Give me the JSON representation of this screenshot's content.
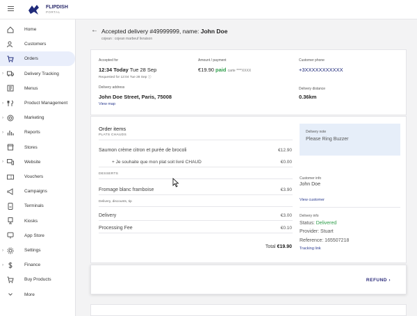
{
  "brand": {
    "name": "FLIPDISH",
    "tag": "PORTAL"
  },
  "sidebar": {
    "items": [
      {
        "label": "Home",
        "icon": "home-icon",
        "caret": false,
        "active": false
      },
      {
        "label": "Customers",
        "icon": "customers-icon",
        "caret": false,
        "active": false
      },
      {
        "label": "Orders",
        "icon": "cart-icon",
        "caret": false,
        "active": true
      },
      {
        "label": "Delivery Tracking",
        "icon": "truck-icon",
        "caret": true,
        "active": false
      },
      {
        "label": "Menus",
        "icon": "menu-book-icon",
        "caret": false,
        "active": false
      },
      {
        "label": "Product Management",
        "icon": "fork-knife-icon",
        "caret": true,
        "active": false
      },
      {
        "label": "Marketing",
        "icon": "target-icon",
        "caret": true,
        "active": false
      },
      {
        "label": "Reports",
        "icon": "bar-chart-icon",
        "caret": true,
        "active": false
      },
      {
        "label": "Stores",
        "icon": "store-icon",
        "caret": false,
        "active": false
      },
      {
        "label": "Website",
        "icon": "devices-icon",
        "caret": true,
        "active": false
      },
      {
        "label": "Vouchers",
        "icon": "voucher-icon",
        "caret": false,
        "active": false
      },
      {
        "label": "Campaigns",
        "icon": "megaphone-icon",
        "caret": false,
        "active": false
      },
      {
        "label": "Terminals",
        "icon": "terminal-icon",
        "caret": false,
        "active": false
      },
      {
        "label": "Kiosks",
        "icon": "kiosk-icon",
        "caret": false,
        "active": false
      },
      {
        "label": "App Store",
        "icon": "app-store-icon",
        "caret": false,
        "active": false
      },
      {
        "label": "Settings",
        "icon": "gear-icon",
        "caret": true,
        "active": false
      },
      {
        "label": "Finance",
        "icon": "dollar-icon",
        "caret": true,
        "active": false
      },
      {
        "label": "Buy Products",
        "icon": "buy-cart-icon",
        "caret": false,
        "active": false
      },
      {
        "label": "More",
        "icon": "chevron-down-icon",
        "caret": false,
        "active": false
      }
    ]
  },
  "header": {
    "title_prefix": "Accepted delivery #49999999, name: ",
    "title_name": "John Doe",
    "subtitle": "cojean : cojean marbeuf livraison"
  },
  "summary": {
    "accepted_for_label": "Accepted for",
    "accepted_time": "12:34 Today",
    "accepted_date": " Tue 28 Sep",
    "requested_for": "Requested for 12:04 Tue 28 Sep",
    "amount_label": "Amount / payment",
    "amount": "€19.90",
    "paid": "paid",
    "card_mask": "carte ****XXXX",
    "phone_label": "Customer phone",
    "phone": "+3XXXXXXXXXXX",
    "address_label": "Delivery address",
    "address": "John Doe Street, Paris, 75008",
    "view_map": "View map",
    "distance_label": "Delivery distance",
    "distance": "0.36km"
  },
  "order": {
    "heading": "Order items",
    "cat1": "PLATS CHAUDS",
    "item1": "Saumon crème citron et purée de brocoli",
    "item1_price": "€12.90",
    "opt1": "+ Je souhaite que mon plat soit livré CHAUD",
    "opt1_price": "€0.00",
    "cat2": "DESSERTS",
    "item2": "Fromage blanc framboise",
    "item2_price": "€3.90",
    "cat3": "Delivery, discounts, tip",
    "delivery": "Delivery",
    "delivery_price": "€3.00",
    "fee": "Processing Fee",
    "fee_price": "€0.10",
    "total_label": "Total",
    "total": "€19.90"
  },
  "side": {
    "note_label": "Delivery note",
    "note": "Please Ring Buzzer",
    "customer_label": "Customer info",
    "customer": "John Doe",
    "view_customer": "View customer",
    "info_label": "Delivery info",
    "status_label": "Status: ",
    "status": "Delivered",
    "provider": "Provider: Stuart",
    "reference": "Reference: 165507218",
    "tracking": "Tracking link"
  },
  "actions": {
    "refund": "REFUND"
  }
}
